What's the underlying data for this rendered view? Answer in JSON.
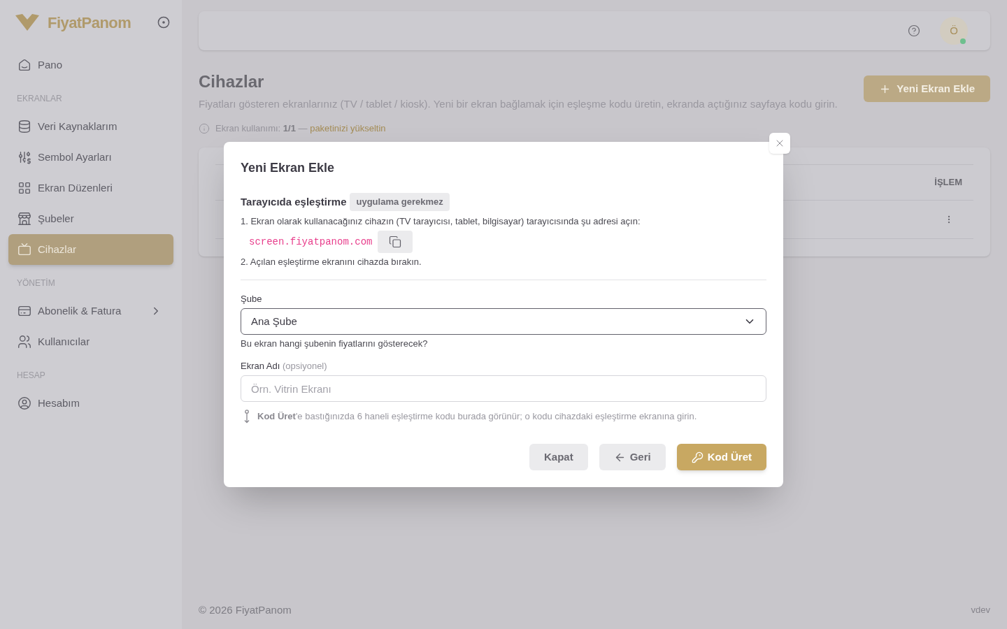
{
  "sidebar": {
    "brand": "FiyatPanom",
    "sections": [
      {
        "items": [
          {
            "label": "Pano",
            "selected": false,
            "submenu": false
          }
        ]
      },
      {
        "title": "EKRANLAR",
        "items": [
          {
            "label": "Veri Kaynaklarım",
            "selected": false,
            "submenu": false
          },
          {
            "label": "Sembol Ayarları",
            "selected": false,
            "submenu": false
          },
          {
            "label": "Ekran Düzenleri",
            "selected": false,
            "submenu": false
          },
          {
            "label": "Şubeler",
            "selected": false,
            "submenu": false
          },
          {
            "label": "Cihazlar",
            "selected": true,
            "submenu": false
          }
        ]
      },
      {
        "title": "YÖNETİM",
        "items": [
          {
            "label": "Abonelik & Fatura",
            "selected": false,
            "submenu": true
          },
          {
            "label": "Kullanıcılar",
            "selected": false,
            "submenu": false
          }
        ]
      },
      {
        "title": "HESAP",
        "items": [
          {
            "label": "Hesabım",
            "selected": false,
            "submenu": false
          }
        ]
      }
    ]
  },
  "header": {
    "avatar": {
      "initial": "Ö",
      "online": true
    }
  },
  "page": {
    "title": "Cihazlar",
    "description": "Fiyatları gösteren ekranlarınız (TV / tablet / kiosk). Yeni bir ekran bağlamak için eşleşme kodu üretin, ekranda açtığınız sayfaya kodu girin.",
    "usage": {
      "text": "Ekran kullanımı: **1/1** —",
      "link": "paketinizi yükseltin"
    },
    "add_button": "Yeni Ekran Ekle"
  },
  "table": {
    "columns": [
      "İŞLEM"
    ],
    "rows": [
      {
        "kind": "menu"
      }
    ]
  },
  "modal": {
    "title": "Yeni Ekran Ekle",
    "section_title": "Tarayıcıda eşleştirme",
    "badge": "uygulama gerekmez",
    "steps": [
      "1. Ekran olarak kullanacağınız cihazın (TV tarayıcısı, tablet, bilgisayar) tarayıcısında şu adresi açın:",
      "2. Açılan eşleştirme ekranını cihazda bırakın."
    ],
    "url": "screen.fiyatpanom.com",
    "fields": [
      {
        "kind": "select",
        "label": "Şube",
        "value": "Ana Şube",
        "hint": "Bu ekran hangi şubenin fiyatlarını gösterecek?"
      },
      {
        "kind": "text",
        "label": "Ekran Adı",
        "optional": "(opsiyonel)",
        "placeholder": "Örn. Vitrin Ekranı"
      }
    ],
    "note": "**Kod Üret**'e bastığınızda 6 haneli eşleştirme kodu burada görünür; o kodu cihazdaki eşleştirme ekranına girin.",
    "buttons": [
      {
        "label": "Kapat",
        "kind": "secondary"
      },
      {
        "label": "Geri",
        "kind": "back"
      },
      {
        "label": "Kod Üret",
        "kind": "primary"
      }
    ]
  },
  "footer": {
    "copyright": "© 2026 FiyatPanom",
    "version": "vdev"
  }
}
